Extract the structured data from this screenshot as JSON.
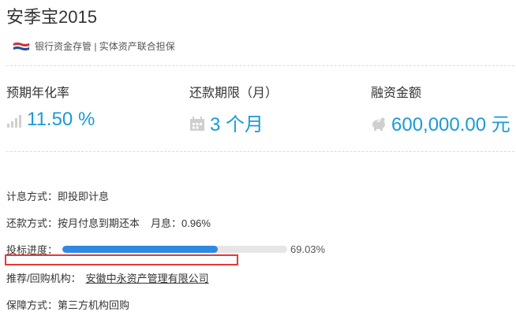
{
  "product": {
    "title": "安季宝2015",
    "guarantee_text": "银行资金存管 | 实体资产联合担保"
  },
  "metrics": {
    "rate": {
      "label": "预期年化率",
      "value": "11.50 %"
    },
    "term": {
      "label": "还款期限（月）",
      "value": "3 个月"
    },
    "amount": {
      "label": "融资金额",
      "value": "600,000.00 元"
    }
  },
  "details": {
    "interest_method": "计息方式：即投即计息",
    "repayment_method": "还款方式：按月付息到期还本",
    "monthly_rate": "月息：0.96%",
    "progress_label": "投标进度：",
    "progress_percent_text": "69.03%",
    "progress_fraction": 0.6903,
    "org_label": "推荐/回购机构：",
    "org_name": "安徽中永资产管理有限公司",
    "guarantee_method": "保障方式：第三方机构回购"
  },
  "colors": {
    "accent": "#1a9ad6",
    "progress": "#2d8ae0",
    "highlight": "#e53935"
  }
}
